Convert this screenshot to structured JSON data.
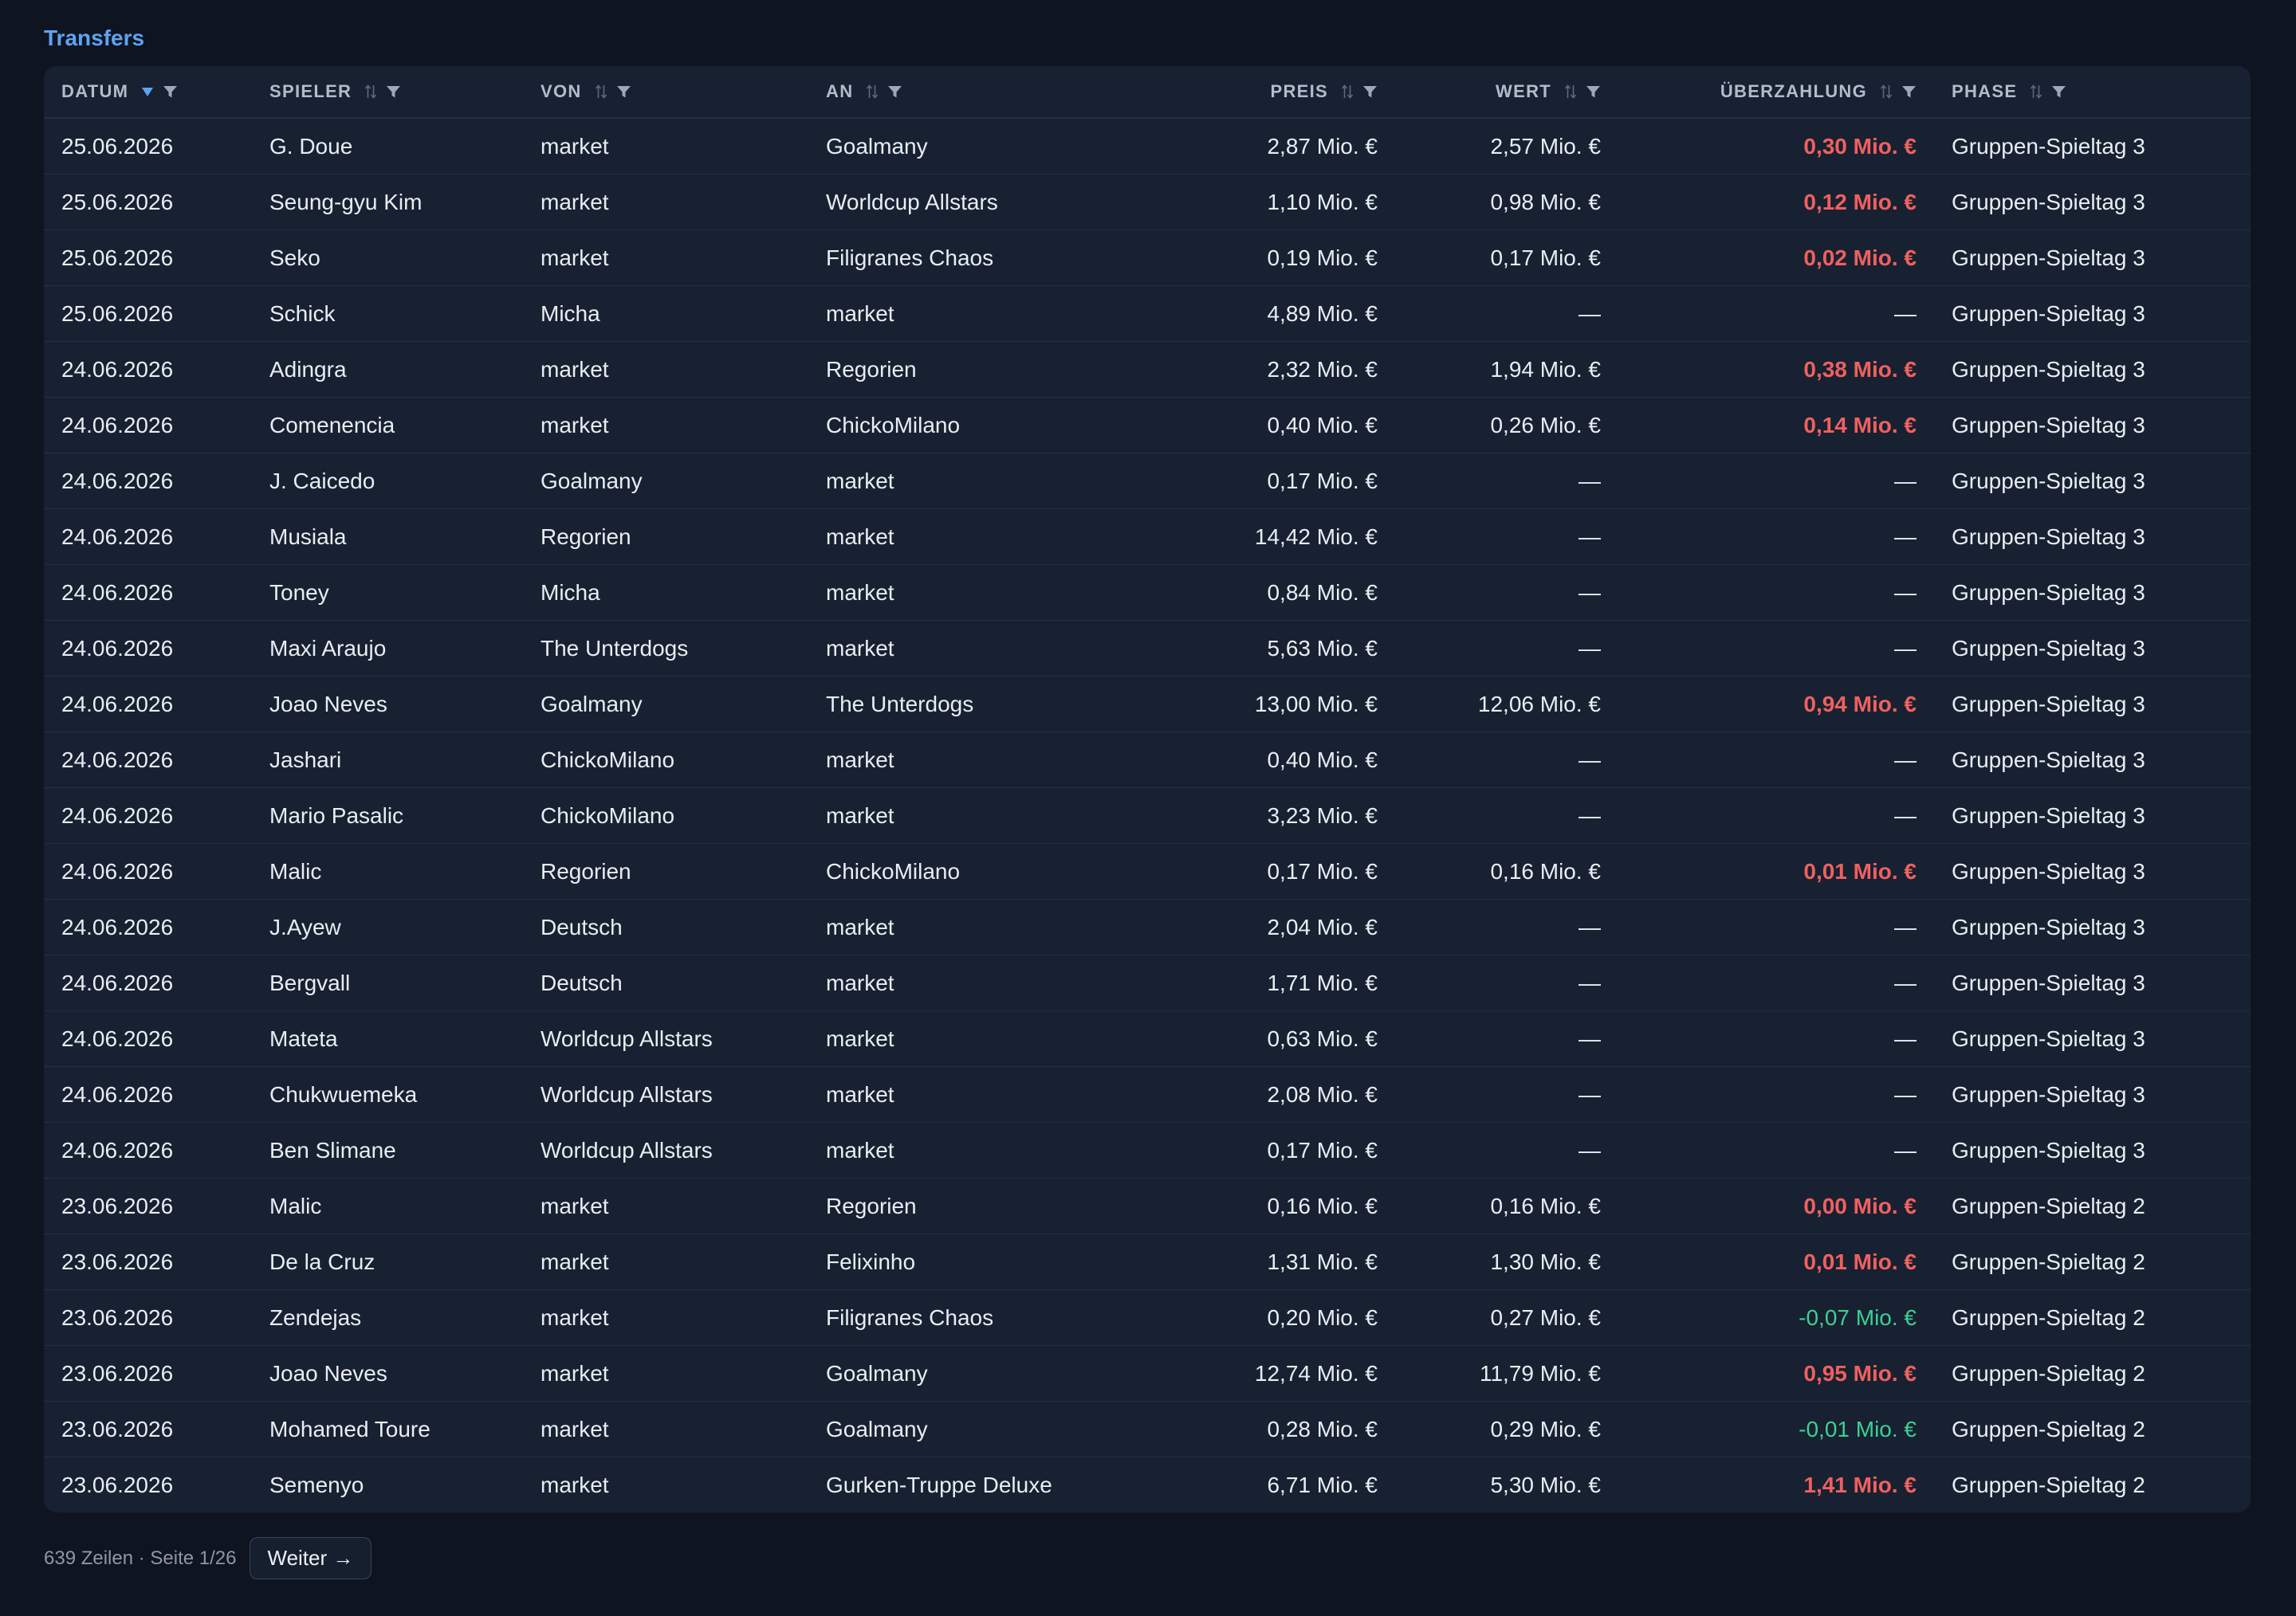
{
  "page": {
    "title": "Transfers"
  },
  "colors": {
    "bg": "#0e1420",
    "panel": "#172131",
    "accent": "#5ea3f2",
    "text": "#e9edf3",
    "muted": "#8d97a7",
    "over": "#f0605f",
    "under": "#3ecf93"
  },
  "table": {
    "columns": [
      {
        "key": "date",
        "label": "DATUM",
        "sort_icon": "sort-desc-icon",
        "filter_icon": "filter-icon"
      },
      {
        "key": "player",
        "label": "SPIELER",
        "sort_icon": "sort-icon",
        "filter_icon": "filter-icon"
      },
      {
        "key": "from",
        "label": "VON",
        "sort_icon": "sort-icon",
        "filter_icon": "filter-icon"
      },
      {
        "key": "to",
        "label": "AN",
        "sort_icon": "sort-icon",
        "filter_icon": "filter-icon"
      },
      {
        "key": "price",
        "label": "PREIS",
        "sort_icon": "sort-icon",
        "filter_icon": "filter-icon"
      },
      {
        "key": "value",
        "label": "WERT",
        "sort_icon": "sort-icon",
        "filter_icon": "filter-icon"
      },
      {
        "key": "overpay",
        "label": "ÜBERZAHLUNG",
        "sort_icon": "sort-icon",
        "filter_icon": "filter-icon"
      },
      {
        "key": "phase",
        "label": "PHASE",
        "sort_icon": "sort-icon",
        "filter_icon": "filter-icon"
      }
    ],
    "rows": [
      {
        "date": "25.06.2026",
        "player": "G. Doue",
        "from": "market",
        "to": "Goalmany",
        "price": "2,87 Mio. €",
        "value": "2,57 Mio. €",
        "overpay": "0,30 Mio. €",
        "overpay_tone": "over",
        "phase": "Gruppen-Spieltag 3"
      },
      {
        "date": "25.06.2026",
        "player": "Seung-gyu Kim",
        "from": "market",
        "to": "Worldcup Allstars",
        "price": "1,10 Mio. €",
        "value": "0,98 Mio. €",
        "overpay": "0,12 Mio. €",
        "overpay_tone": "over",
        "phase": "Gruppen-Spieltag 3"
      },
      {
        "date": "25.06.2026",
        "player": "Seko",
        "from": "market",
        "to": "Filigranes Chaos",
        "price": "0,19 Mio. €",
        "value": "0,17 Mio. €",
        "overpay": "0,02 Mio. €",
        "overpay_tone": "over",
        "phase": "Gruppen-Spieltag 3"
      },
      {
        "date": "25.06.2026",
        "player": "Schick",
        "from": "Micha",
        "to": "market",
        "price": "4,89 Mio. €",
        "value": "—",
        "overpay": "—",
        "overpay_tone": "none",
        "phase": "Gruppen-Spieltag 3"
      },
      {
        "date": "24.06.2026",
        "player": "Adingra",
        "from": "market",
        "to": "Regorien",
        "price": "2,32 Mio. €",
        "value": "1,94 Mio. €",
        "overpay": "0,38 Mio. €",
        "overpay_tone": "over",
        "phase": "Gruppen-Spieltag 3"
      },
      {
        "date": "24.06.2026",
        "player": "Comenencia",
        "from": "market",
        "to": "ChickoMilano",
        "price": "0,40 Mio. €",
        "value": "0,26 Mio. €",
        "overpay": "0,14 Mio. €",
        "overpay_tone": "over",
        "phase": "Gruppen-Spieltag 3"
      },
      {
        "date": "24.06.2026",
        "player": "J. Caicedo",
        "from": "Goalmany",
        "to": "market",
        "price": "0,17 Mio. €",
        "value": "—",
        "overpay": "—",
        "overpay_tone": "none",
        "phase": "Gruppen-Spieltag 3"
      },
      {
        "date": "24.06.2026",
        "player": "Musiala",
        "from": "Regorien",
        "to": "market",
        "price": "14,42 Mio. €",
        "value": "—",
        "overpay": "—",
        "overpay_tone": "none",
        "phase": "Gruppen-Spieltag 3"
      },
      {
        "date": "24.06.2026",
        "player": "Toney",
        "from": "Micha",
        "to": "market",
        "price": "0,84 Mio. €",
        "value": "—",
        "overpay": "—",
        "overpay_tone": "none",
        "phase": "Gruppen-Spieltag 3"
      },
      {
        "date": "24.06.2026",
        "player": "Maxi Araujo",
        "from": "The Unterdogs",
        "to": "market",
        "price": "5,63 Mio. €",
        "value": "—",
        "overpay": "—",
        "overpay_tone": "none",
        "phase": "Gruppen-Spieltag 3"
      },
      {
        "date": "24.06.2026",
        "player": "Joao Neves",
        "from": "Goalmany",
        "to": "The Unterdogs",
        "price": "13,00 Mio. €",
        "value": "12,06 Mio. €",
        "overpay": "0,94 Mio. €",
        "overpay_tone": "over",
        "phase": "Gruppen-Spieltag 3"
      },
      {
        "date": "24.06.2026",
        "player": "Jashari",
        "from": "ChickoMilano",
        "to": "market",
        "price": "0,40 Mio. €",
        "value": "—",
        "overpay": "—",
        "overpay_tone": "none",
        "phase": "Gruppen-Spieltag 3"
      },
      {
        "date": "24.06.2026",
        "player": "Mario Pasalic",
        "from": "ChickoMilano",
        "to": "market",
        "price": "3,23 Mio. €",
        "value": "—",
        "overpay": "—",
        "overpay_tone": "none",
        "phase": "Gruppen-Spieltag 3"
      },
      {
        "date": "24.06.2026",
        "player": "Malic",
        "from": "Regorien",
        "to": "ChickoMilano",
        "price": "0,17 Mio. €",
        "value": "0,16 Mio. €",
        "overpay": "0,01 Mio. €",
        "overpay_tone": "over",
        "phase": "Gruppen-Spieltag 3"
      },
      {
        "date": "24.06.2026",
        "player": "J.Ayew",
        "from": "Deutsch",
        "to": "market",
        "price": "2,04 Mio. €",
        "value": "—",
        "overpay": "—",
        "overpay_tone": "none",
        "phase": "Gruppen-Spieltag 3"
      },
      {
        "date": "24.06.2026",
        "player": "Bergvall",
        "from": "Deutsch",
        "to": "market",
        "price": "1,71 Mio. €",
        "value": "—",
        "overpay": "—",
        "overpay_tone": "none",
        "phase": "Gruppen-Spieltag 3"
      },
      {
        "date": "24.06.2026",
        "player": "Mateta",
        "from": "Worldcup Allstars",
        "to": "market",
        "price": "0,63 Mio. €",
        "value": "—",
        "overpay": "—",
        "overpay_tone": "none",
        "phase": "Gruppen-Spieltag 3"
      },
      {
        "date": "24.06.2026",
        "player": "Chukwuemeka",
        "from": "Worldcup Allstars",
        "to": "market",
        "price": "2,08 Mio. €",
        "value": "—",
        "overpay": "—",
        "overpay_tone": "none",
        "phase": "Gruppen-Spieltag 3"
      },
      {
        "date": "24.06.2026",
        "player": "Ben Slimane",
        "from": "Worldcup Allstars",
        "to": "market",
        "price": "0,17 Mio. €",
        "value": "—",
        "overpay": "—",
        "overpay_tone": "none",
        "phase": "Gruppen-Spieltag 3"
      },
      {
        "date": "23.06.2026",
        "player": "Malic",
        "from": "market",
        "to": "Regorien",
        "price": "0,16 Mio. €",
        "value": "0,16 Mio. €",
        "overpay": "0,00 Mio. €",
        "overpay_tone": "over",
        "phase": "Gruppen-Spieltag 2"
      },
      {
        "date": "23.06.2026",
        "player": "De la Cruz",
        "from": "market",
        "to": "Felixinho",
        "price": "1,31 Mio. €",
        "value": "1,30 Mio. €",
        "overpay": "0,01 Mio. €",
        "overpay_tone": "over",
        "phase": "Gruppen-Spieltag 2"
      },
      {
        "date": "23.06.2026",
        "player": "Zendejas",
        "from": "market",
        "to": "Filigranes Chaos",
        "price": "0,20 Mio. €",
        "value": "0,27 Mio. €",
        "overpay": "-0,07 Mio. €",
        "overpay_tone": "under",
        "phase": "Gruppen-Spieltag 2"
      },
      {
        "date": "23.06.2026",
        "player": "Joao Neves",
        "from": "market",
        "to": "Goalmany",
        "price": "12,74 Mio. €",
        "value": "11,79 Mio. €",
        "overpay": "0,95 Mio. €",
        "overpay_tone": "over",
        "phase": "Gruppen-Spieltag 2"
      },
      {
        "date": "23.06.2026",
        "player": "Mohamed Toure",
        "from": "market",
        "to": "Goalmany",
        "price": "0,28 Mio. €",
        "value": "0,29 Mio. €",
        "overpay": "-0,01 Mio. €",
        "overpay_tone": "under",
        "phase": "Gruppen-Spieltag 2"
      },
      {
        "date": "23.06.2026",
        "player": "Semenyo",
        "from": "market",
        "to": "Gurken-Truppe Deluxe",
        "price": "6,71 Mio. €",
        "value": "5,30 Mio. €",
        "overpay": "1,41 Mio. €",
        "overpay_tone": "over",
        "phase": "Gruppen-Spieltag 2"
      }
    ]
  },
  "footer": {
    "status": "639 Zeilen · Seite 1/26",
    "next_label": "Weiter →"
  }
}
